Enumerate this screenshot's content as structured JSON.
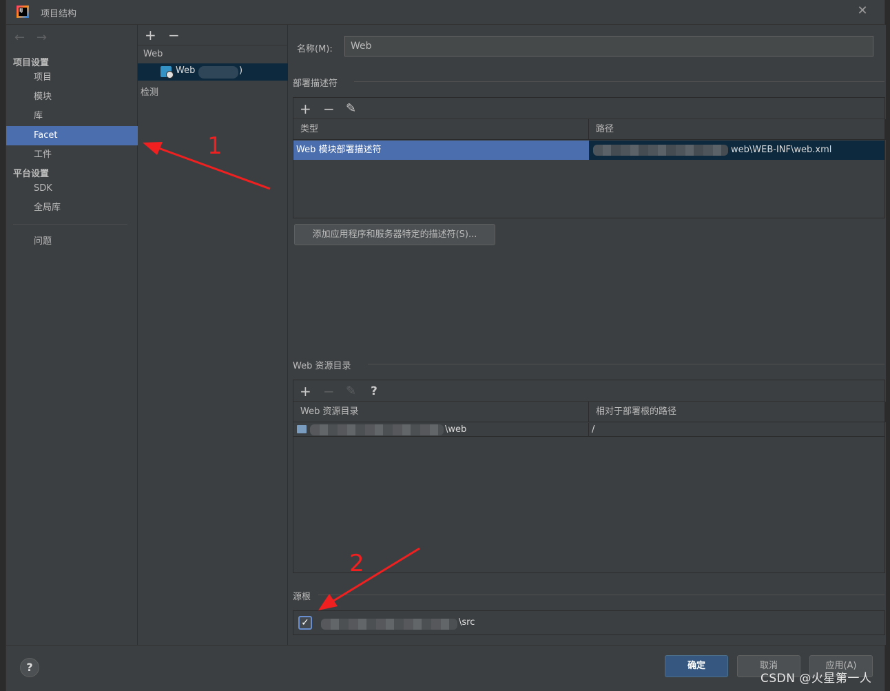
{
  "window": {
    "title": "项目结构",
    "logo_text": "IJ",
    "close_icon": "close-icon"
  },
  "nav": {
    "back_icon": "←",
    "forward_icon": "→",
    "project_settings_title": "项目设置",
    "project_settings": [
      {
        "label": "项目",
        "selected": false
      },
      {
        "label": "模块",
        "selected": false
      },
      {
        "label": "库",
        "selected": false
      },
      {
        "label": "Facet",
        "selected": true
      },
      {
        "label": "工件",
        "selected": false
      }
    ],
    "platform_settings_title": "平台设置",
    "platform_settings": [
      {
        "label": "SDK"
      },
      {
        "label": "全局库"
      }
    ],
    "problems_label": "问题"
  },
  "facets": {
    "add_icon": "+",
    "remove_icon": "−",
    "tree_root": "Web",
    "selected_item": "Web",
    "selected_item_suffix": ")",
    "detection_label": "检测"
  },
  "form": {
    "name_label": "名称(M):",
    "name_value": "Web"
  },
  "deployment": {
    "title": "部署描述符",
    "toolbar": {
      "add": "+",
      "remove": "−",
      "edit": "✎"
    },
    "columns": [
      "类型",
      "路径"
    ],
    "rows": [
      {
        "type": "Web 模块部署描述符",
        "path_suffix": "web\\WEB-INF\\web.xml"
      }
    ],
    "add_button": "添加应用程序和服务器特定的描述符(S)..."
  },
  "web_resources": {
    "title": "Web 资源目录",
    "toolbar": {
      "add": "+",
      "remove": "−",
      "edit": "✎",
      "help": "?"
    },
    "columns": [
      "Web 资源目录",
      "相对于部署根的路径"
    ],
    "rows": [
      {
        "dir_suffix": "\\web",
        "relative": "/"
      }
    ]
  },
  "source_roots": {
    "title": "源根",
    "items": [
      {
        "checked": true,
        "path_suffix": "\\src"
      }
    ]
  },
  "footer": {
    "help": "?",
    "ok": "确定",
    "cancel": "取消",
    "apply": "应用(A)"
  },
  "annotations": {
    "marker1": "1",
    "marker2": "2",
    "color": "#f02020"
  },
  "watermark": "CSDN @火星第一人"
}
